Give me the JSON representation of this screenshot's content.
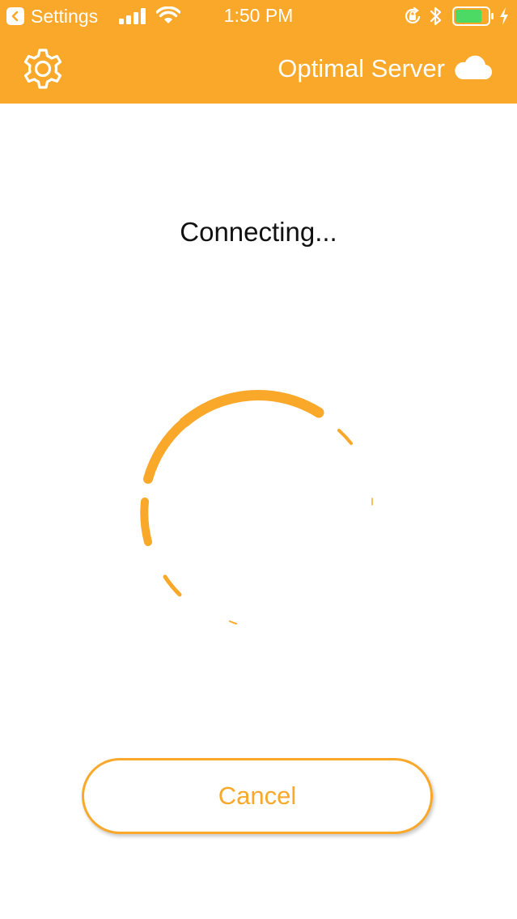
{
  "status_bar": {
    "back_app_label": "Settings",
    "time": "1:50 PM",
    "icons": [
      "back-chevron-icon",
      "signal-icon",
      "wifi-icon",
      "orientation-lock-icon",
      "bluetooth-icon",
      "battery-icon",
      "charging-icon"
    ]
  },
  "nav": {
    "settings_icon": "gear-icon",
    "server_label": "Optimal Server",
    "server_icon": "cloud-icon"
  },
  "main": {
    "status_text": "Connecting...",
    "cancel_label": "Cancel"
  },
  "colors": {
    "accent": "#F9A82A",
    "background": "#FFFFFF",
    "text": "#111111",
    "battery_fill": "#4CD964"
  }
}
